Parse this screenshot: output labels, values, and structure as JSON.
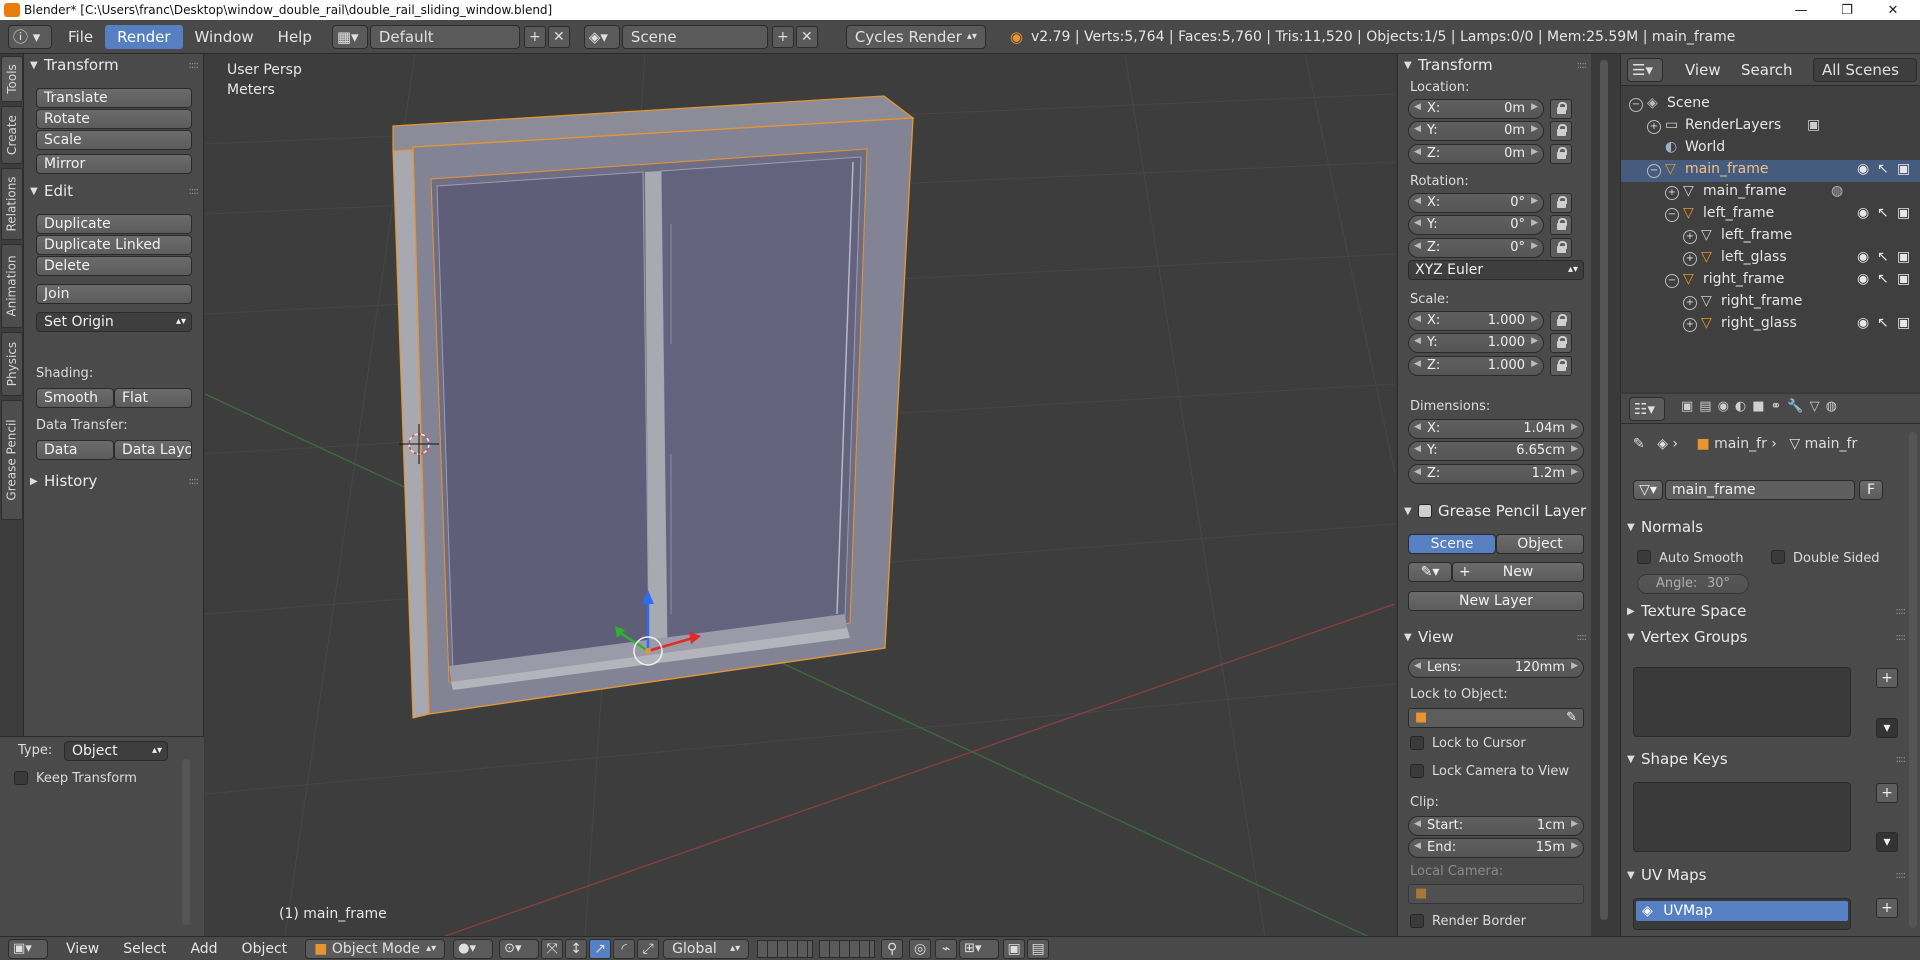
{
  "window": {
    "title": "Blender* [C:\\Users\\franc\\Desktop\\window_double_rail\\double_rail_sliding_window.blend]",
    "controls": [
      "—",
      "❐",
      "✕"
    ]
  },
  "infobar": {
    "menus": [
      "File",
      "Render",
      "Window",
      "Help"
    ],
    "active_menu": "Render",
    "layout": "Default",
    "scene": "Scene",
    "engine": "Cycles Render",
    "stats": "v2.79 | Verts:5,764 | Faces:5,760 | Tris:11,520 | Objects:1/5 | Lamps:0/0 | Mem:25.59M | main_frame"
  },
  "toolshelf": {
    "tabs": [
      "Tools",
      "Create",
      "Relations",
      "Animation",
      "Physics",
      "Grease Pencil"
    ],
    "transform": {
      "title": "Transform",
      "buttons": [
        "Translate",
        "Rotate",
        "Scale",
        "Mirror"
      ]
    },
    "edit": {
      "title": "Edit",
      "buttons": [
        "Duplicate",
        "Duplicate Linked",
        "Delete",
        "Join"
      ],
      "set_origin": "Set Origin",
      "shading_label": "Shading:",
      "smooth": "Smooth",
      "flat": "Flat",
      "data_transfer_label": "Data Transfer:",
      "data": "Data",
      "data_layout": "Data Layo"
    },
    "history": "History"
  },
  "operator": {
    "type_label": "Type:",
    "type_value": "Object",
    "keep_transform": "Keep Transform"
  },
  "viewport": {
    "view_name": "User Persp",
    "units": "Meters",
    "active_object": "(1) main_frame"
  },
  "npanel": {
    "transform_title": "Transform",
    "location_label": "Location:",
    "location": [
      {
        "k": "X:",
        "v": "0m"
      },
      {
        "k": "Y:",
        "v": "0m"
      },
      {
        "k": "Z:",
        "v": "0m"
      }
    ],
    "rotation_label": "Rotation:",
    "rotation": [
      {
        "k": "X:",
        "v": "0°"
      },
      {
        "k": "Y:",
        "v": "0°"
      },
      {
        "k": "Z:",
        "v": "0°"
      }
    ],
    "rotation_mode": "XYZ Euler",
    "scale_label": "Scale:",
    "scale": [
      {
        "k": "X:",
        "v": "1.000"
      },
      {
        "k": "Y:",
        "v": "1.000"
      },
      {
        "k": "Z:",
        "v": "1.000"
      }
    ],
    "dimensions_label": "Dimensions:",
    "dimensions": [
      {
        "k": "X:",
        "v": "1.04m"
      },
      {
        "k": "Y:",
        "v": "6.65cm"
      },
      {
        "k": "Z:",
        "v": "1.2m"
      }
    ],
    "gp_title": "Grease Pencil Layer",
    "gp_scene": "Scene",
    "gp_object": "Object",
    "gp_new": "New",
    "gp_new_layer": "New Layer",
    "view_title": "View",
    "lens_label": "Lens:",
    "lens_value": "120mm",
    "lock_to_object": "Lock to Object:",
    "lock_to_cursor": "Lock to Cursor",
    "lock_camera": "Lock Camera to View",
    "clip_label": "Clip:",
    "clip_start_label": "Start:",
    "clip_start": "1cm",
    "clip_end_label": "End:",
    "clip_end": "15m",
    "local_camera": "Local Camera:",
    "render_border": "Render Border"
  },
  "outliner": {
    "view": "View",
    "search": "Search",
    "filter": "All Scenes",
    "rows": [
      "Scene",
      "RenderLayers",
      "World",
      "main_frame",
      "main_frame",
      "left_frame",
      "left_frame",
      "left_glass",
      "right_frame",
      "right_frame",
      "right_glass"
    ]
  },
  "properties": {
    "crumb1": "main_fr",
    "crumb2": "main_fr",
    "mesh_name": "main_frame",
    "fake_user": "F",
    "normals_title": "Normals",
    "auto_smooth": "Auto Smooth",
    "double_sided": "Double Sided",
    "angle_label": "Angle:",
    "angle_value": "30°",
    "texture_space": "Texture Space",
    "vertex_groups": "Vertex Groups",
    "shape_keys": "Shape Keys",
    "uv_maps": "UV Maps",
    "uv_map_name": "UVMap"
  },
  "bottombar": {
    "menus": [
      "View",
      "Select",
      "Add",
      "Object"
    ],
    "mode": "Object Mode",
    "orientation": "Global"
  },
  "colors": {
    "accent": "#5680c2",
    "selection_outline": "#e8952f",
    "glass": "#6b6a82",
    "frame": "#8a8b9c"
  }
}
